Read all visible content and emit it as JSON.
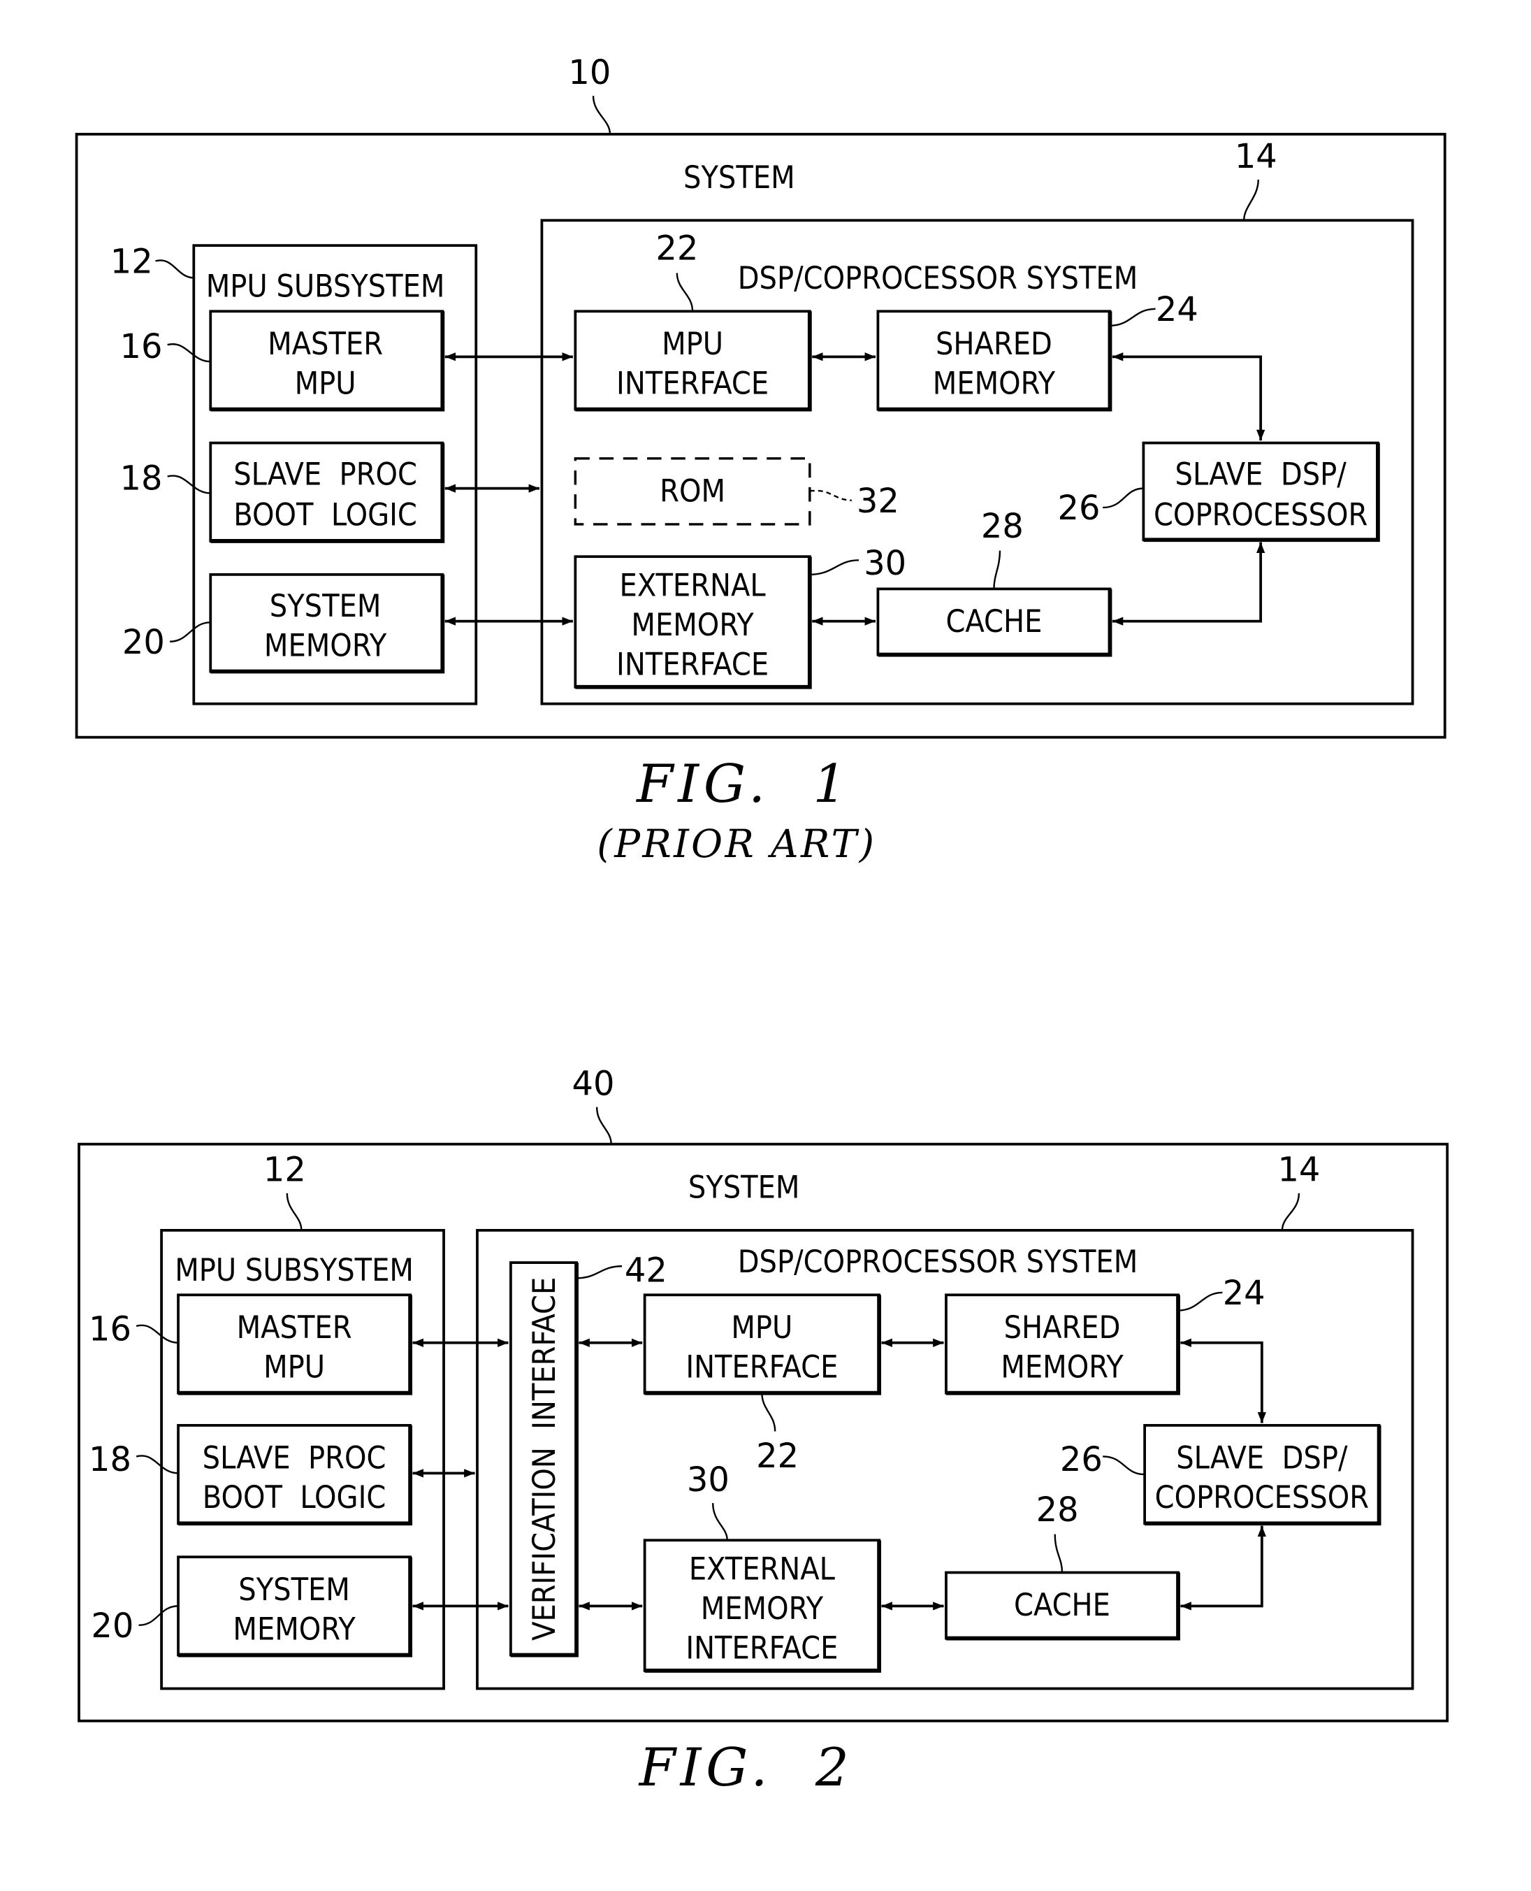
{
  "figures": [
    {
      "ref": "10",
      "caption": "FIG.  1",
      "subcaption": "(PRIOR ART)",
      "system_label": "SYSTEM",
      "mpu_subsystem": {
        "ref": "12",
        "label": "MPU SUBSYSTEM"
      },
      "dsp_system": {
        "ref": "14",
        "label": "DSP/COPROCESSOR SYSTEM"
      },
      "blocks": {
        "master_mpu": {
          "ref": "16",
          "line1": "MASTER",
          "line2": "MPU"
        },
        "slave_boot": {
          "ref": "18",
          "line1": "SLAVE  PROC",
          "line2": "BOOT  LOGIC"
        },
        "system_memory": {
          "ref": "20",
          "line1": "SYSTEM",
          "line2": "MEMORY"
        },
        "mpu_interface": {
          "ref": "22",
          "line1": "MPU",
          "line2": "INTERFACE"
        },
        "shared_memory": {
          "ref": "24",
          "line1": "SHARED",
          "line2": "MEMORY"
        },
        "slave_dsp": {
          "ref": "26",
          "line1": "SLAVE  DSP/",
          "line2": "COPROCESSOR"
        },
        "cache": {
          "ref": "28",
          "line1": "CACHE"
        },
        "ext_mem_if": {
          "ref": "30",
          "line1": "EXTERNAL",
          "line2": "MEMORY",
          "line3": "INTERFACE"
        },
        "rom": {
          "ref": "32",
          "line1": "ROM"
        }
      }
    },
    {
      "ref": "40",
      "caption": "FIG.  2",
      "system_label": "SYSTEM",
      "mpu_subsystem": {
        "ref": "12",
        "label": "MPU SUBSYSTEM"
      },
      "dsp_system": {
        "ref": "14",
        "label": "DSP/COPROCESSOR SYSTEM"
      },
      "verification_interface": {
        "ref": "42",
        "label": "VERIFICATION  INTERFACE"
      },
      "blocks": {
        "master_mpu": {
          "ref": "16",
          "line1": "MASTER",
          "line2": "MPU"
        },
        "slave_boot": {
          "ref": "18",
          "line1": "SLAVE  PROC",
          "line2": "BOOT  LOGIC"
        },
        "system_memory": {
          "ref": "20",
          "line1": "SYSTEM",
          "line2": "MEMORY"
        },
        "mpu_interface": {
          "ref": "22",
          "line1": "MPU",
          "line2": "INTERFACE"
        },
        "shared_memory": {
          "ref": "24",
          "line1": "SHARED",
          "line2": "MEMORY"
        },
        "slave_dsp": {
          "ref": "26",
          "line1": "SLAVE  DSP/",
          "line2": "COPROCESSOR"
        },
        "cache": {
          "ref": "28",
          "line1": "CACHE"
        },
        "ext_mem_if": {
          "ref": "30",
          "line1": "EXTERNAL",
          "line2": "MEMORY",
          "line3": "INTERFACE"
        }
      }
    }
  ]
}
